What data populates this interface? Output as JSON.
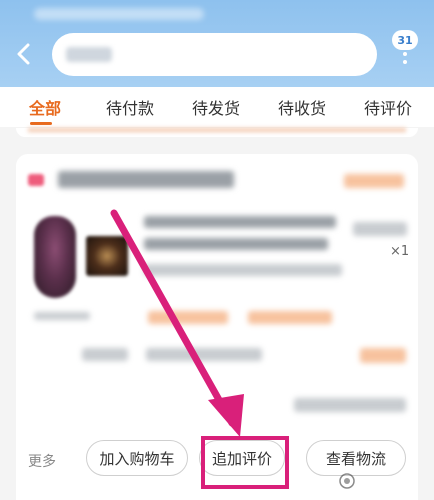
{
  "header": {
    "notification_count": "31",
    "icons": [
      "back-icon",
      "more-vertical-icon"
    ]
  },
  "tabs": [
    {
      "label": "全部",
      "active": true
    },
    {
      "label": "待付款",
      "active": false
    },
    {
      "label": "待发货",
      "active": false
    },
    {
      "label": "待收货",
      "active": false
    },
    {
      "label": "待评价",
      "active": false
    }
  ],
  "order": {
    "quantity": "×1",
    "actions": {
      "more": "更多",
      "add_to_cart": "加入购物车",
      "add_review": "追加评价",
      "view_logistics": "查看物流"
    }
  },
  "colors": {
    "header": "#9ccaf1",
    "accent": "#e86a1e",
    "annotation": "#d9207a"
  }
}
